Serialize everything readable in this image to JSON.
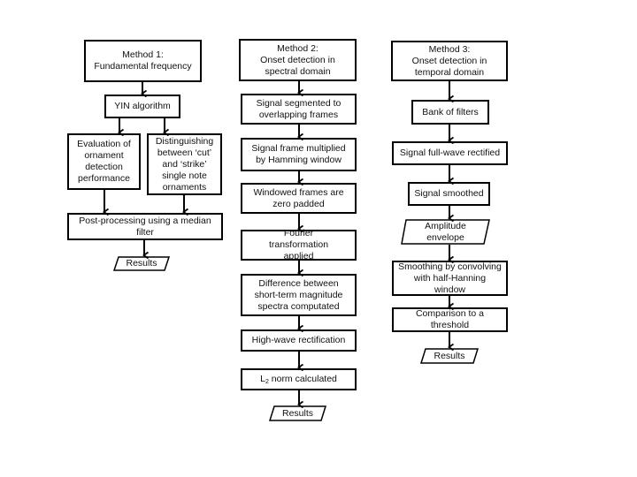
{
  "diagram": {
    "type": "flowchart",
    "columns": [
      {
        "id": "method1",
        "header": "Method 1:\nFundamental frequency",
        "steps": {
          "yin": "YIN algorithm",
          "evaluation": "Evaluation of ornament detection performance",
          "distinguishing": "Distinguishing between ‘cut’ and ‘strike’ single note ornaments",
          "postprocessing": "Post-processing using a median filter",
          "results": "Results"
        }
      },
      {
        "id": "method2",
        "header": "Method 2:\nOnset detection in spectral domain",
        "steps": {
          "segmented": "Signal segmented to overlapping frames",
          "hamming": "Signal frame multiplied by Hamming window",
          "zeropad": "Windowed frames are zero padded",
          "fourier": "Fourier transformation applied",
          "difference": "Difference between short-term magnitude spectra computated",
          "highwave": "High-wave rectification",
          "l2_prefix": "L",
          "l2_sub": "2",
          "l2_suffix": " norm calculated",
          "results": "Results"
        }
      },
      {
        "id": "method3",
        "header": "Method 3:\nOnset detection in temporal domain",
        "steps": {
          "bank": "Bank of filters",
          "fullwave": "Signal full-wave rectified",
          "smoothed": "Signal smoothed",
          "envelope": "Amplitude envelope",
          "convolving": "Smoothing by convolving with half-Hanning window",
          "threshold": "Comparison to a threshold",
          "results": "Results"
        }
      }
    ]
  }
}
